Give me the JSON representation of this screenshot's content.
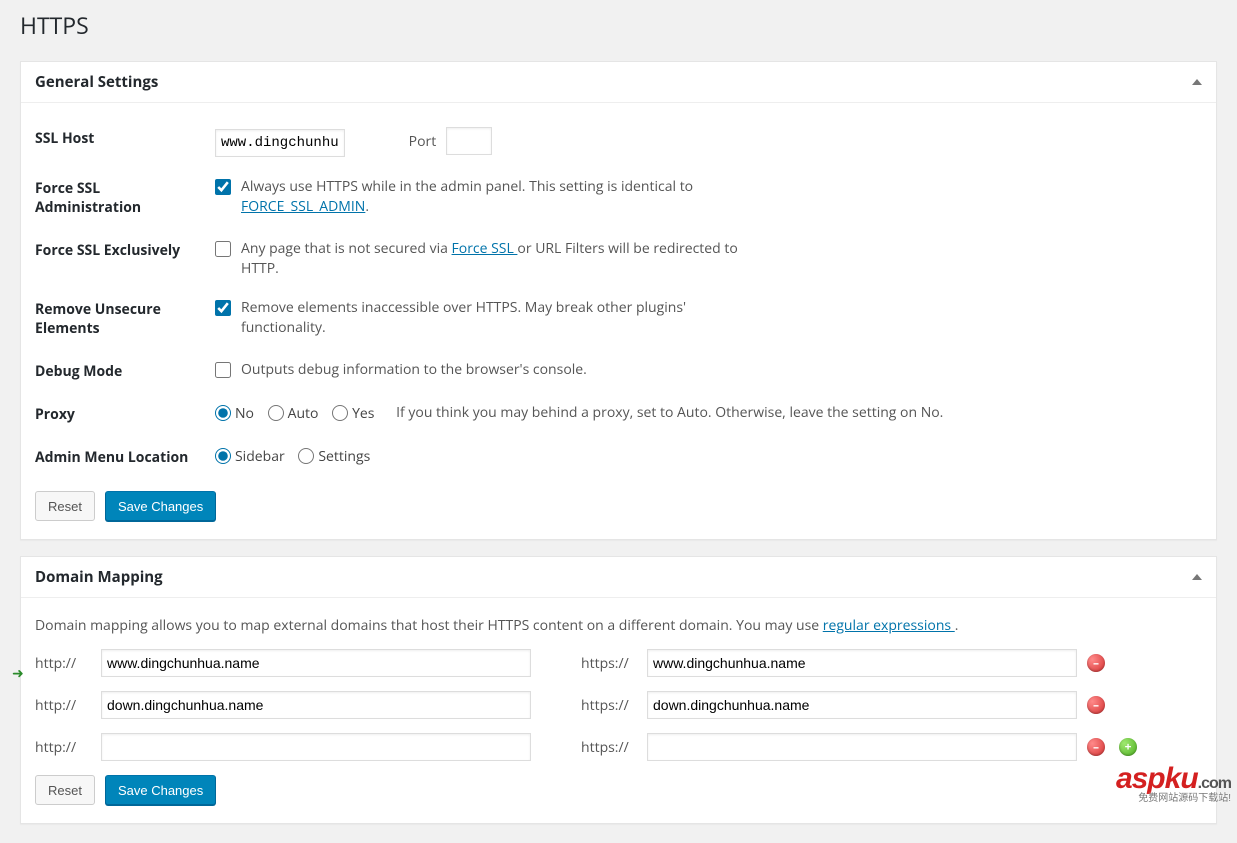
{
  "page": {
    "title": "HTTPS"
  },
  "general": {
    "panel_title": "General Settings",
    "ssl_host": {
      "label": "SSL Host",
      "value": "www.dingchunhu",
      "port_label": "Port",
      "port_value": ""
    },
    "force_admin": {
      "label": "Force SSL Administration",
      "checked": true,
      "desc_before": "Always use HTTPS while in the admin panel. This setting is identical to ",
      "link": "FORCE_SSL_ADMIN",
      "desc_after": "."
    },
    "force_excl": {
      "label": "Force SSL Exclusively",
      "checked": false,
      "desc_before": "Any page that is not secured via ",
      "link": "Force SSL ",
      "desc_after": "or URL Filters will be redirected to HTTP."
    },
    "remove_unsecure": {
      "label": "Remove Unsecure Elements",
      "checked": true,
      "desc": "Remove elements inaccessible over HTTPS. May break other plugins' functionality."
    },
    "debug": {
      "label": "Debug Mode",
      "checked": false,
      "desc": "Outputs debug information to the browser's console."
    },
    "proxy": {
      "label": "Proxy",
      "options": {
        "no": "No",
        "auto": "Auto",
        "yes": "Yes"
      },
      "selected": "no",
      "hint": "If you think you may behind a proxy, set to Auto. Otherwise, leave the setting on No."
    },
    "admin_menu": {
      "label": "Admin Menu Location",
      "options": {
        "sidebar": "Sidebar",
        "settings": "Settings"
      },
      "selected": "sidebar"
    },
    "buttons": {
      "reset": "Reset",
      "save": "Save Changes"
    }
  },
  "domain_mapping": {
    "panel_title": "Domain Mapping",
    "desc_before": "Domain mapping allows you to map external domains that host their HTTPS content on a different domain. You may use ",
    "link": "regular expressions ",
    "desc_after": ".",
    "http_label": "http://",
    "https_label": "https://",
    "rows": [
      {
        "http": "www.dingchunhua.name",
        "https": "www.dingchunhua.name",
        "can_add": false
      },
      {
        "http": "down.dingchunhua.name",
        "https": "down.dingchunhua.name",
        "can_add": false
      },
      {
        "http": "",
        "https": "",
        "can_add": true
      }
    ],
    "buttons": {
      "reset": "Reset",
      "save": "Save Changes"
    }
  },
  "watermark": {
    "brand": "aspku",
    "tld": ".com",
    "sub": "免费网站源码下载站!"
  }
}
